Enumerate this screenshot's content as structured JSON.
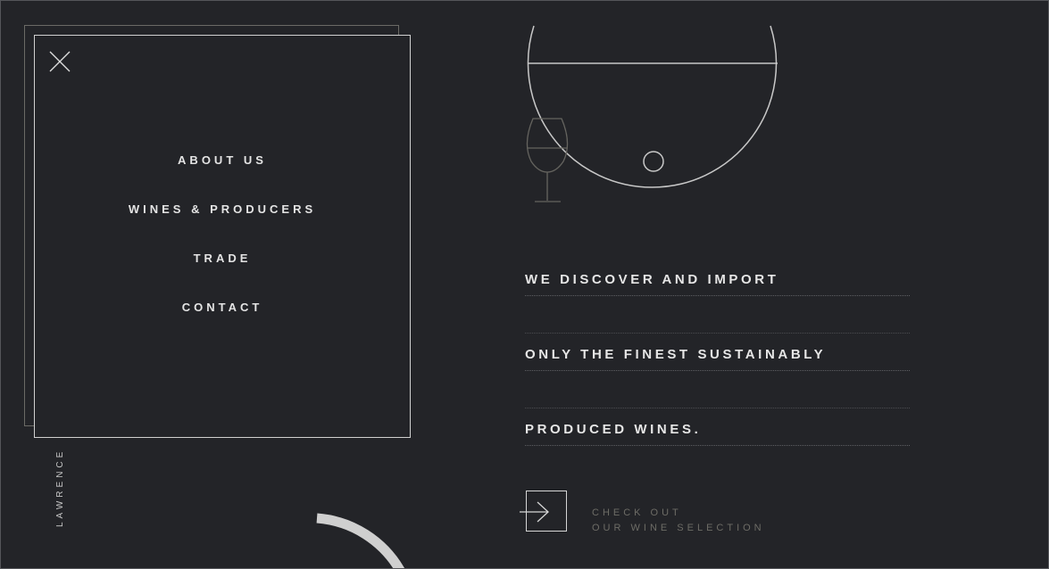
{
  "brand": {
    "vertical_name": "LAWRENCE"
  },
  "menu": {
    "close_icon": "close-x-icon",
    "items": [
      {
        "label": "ABOUT US"
      },
      {
        "label": "WINES & PRODUCERS"
      },
      {
        "label": "TRADE"
      },
      {
        "label": "CONTACT"
      }
    ]
  },
  "hero": {
    "tagline_lines": [
      "WE DISCOVER AND IMPORT",
      "ONLY THE FINEST SUSTAINABLY",
      "PRODUCED WINES."
    ]
  },
  "cta": {
    "icon": "arrow-right-icon",
    "line1": "CHECK OUT",
    "line2": "OUR WINE SELECTION"
  },
  "colors": {
    "background": "#232428",
    "line_light": "#d0d0d0",
    "text_primary": "#e6e6e6",
    "text_muted": "#6d6c66"
  }
}
